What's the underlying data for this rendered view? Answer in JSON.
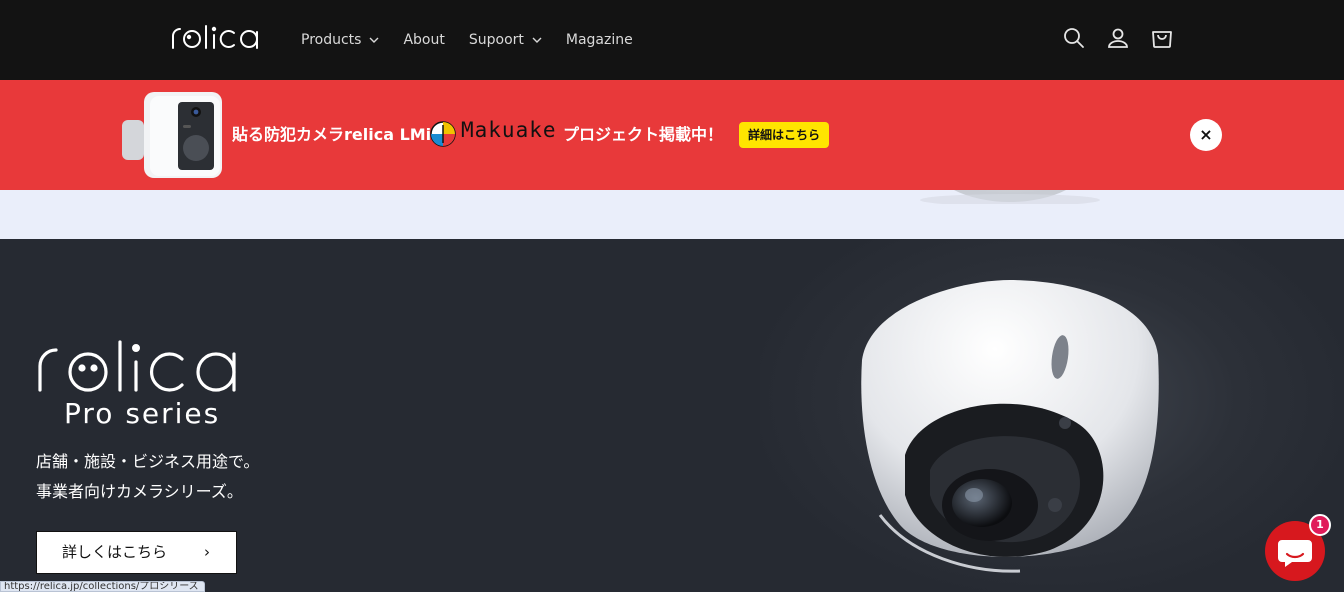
{
  "header": {
    "logo_text": "relica",
    "nav": [
      {
        "label": "Products",
        "has_dropdown": true
      },
      {
        "label": "About",
        "has_dropdown": false
      },
      {
        "label": "Supoort",
        "has_dropdown": true
      },
      {
        "label": "Magazine",
        "has_dropdown": false
      }
    ],
    "icons": [
      "search-icon",
      "account-icon",
      "cart-icon"
    ]
  },
  "banner": {
    "text_before": "貼る防犯カメラrelica LMi",
    "partner_name": "Makuake",
    "text_after": "プロジェクト掲載中！",
    "button_label": "詳細はこちら",
    "close_label": "×",
    "background": "#e8393a",
    "button_color": "#ffe500"
  },
  "hero": {
    "logo_text": "relica",
    "subtitle": "Pro series",
    "description_line1": "店舗・施設・ビジネス用途で。",
    "description_line2": "事業者向けカメラシリーズ。",
    "button_label": "詳しくはこちら",
    "button_arrow": "›"
  },
  "status_url": "https://relica.jp/collections/プロシリーズ",
  "chat": {
    "badge_count": "1",
    "color": "#d7181e"
  }
}
